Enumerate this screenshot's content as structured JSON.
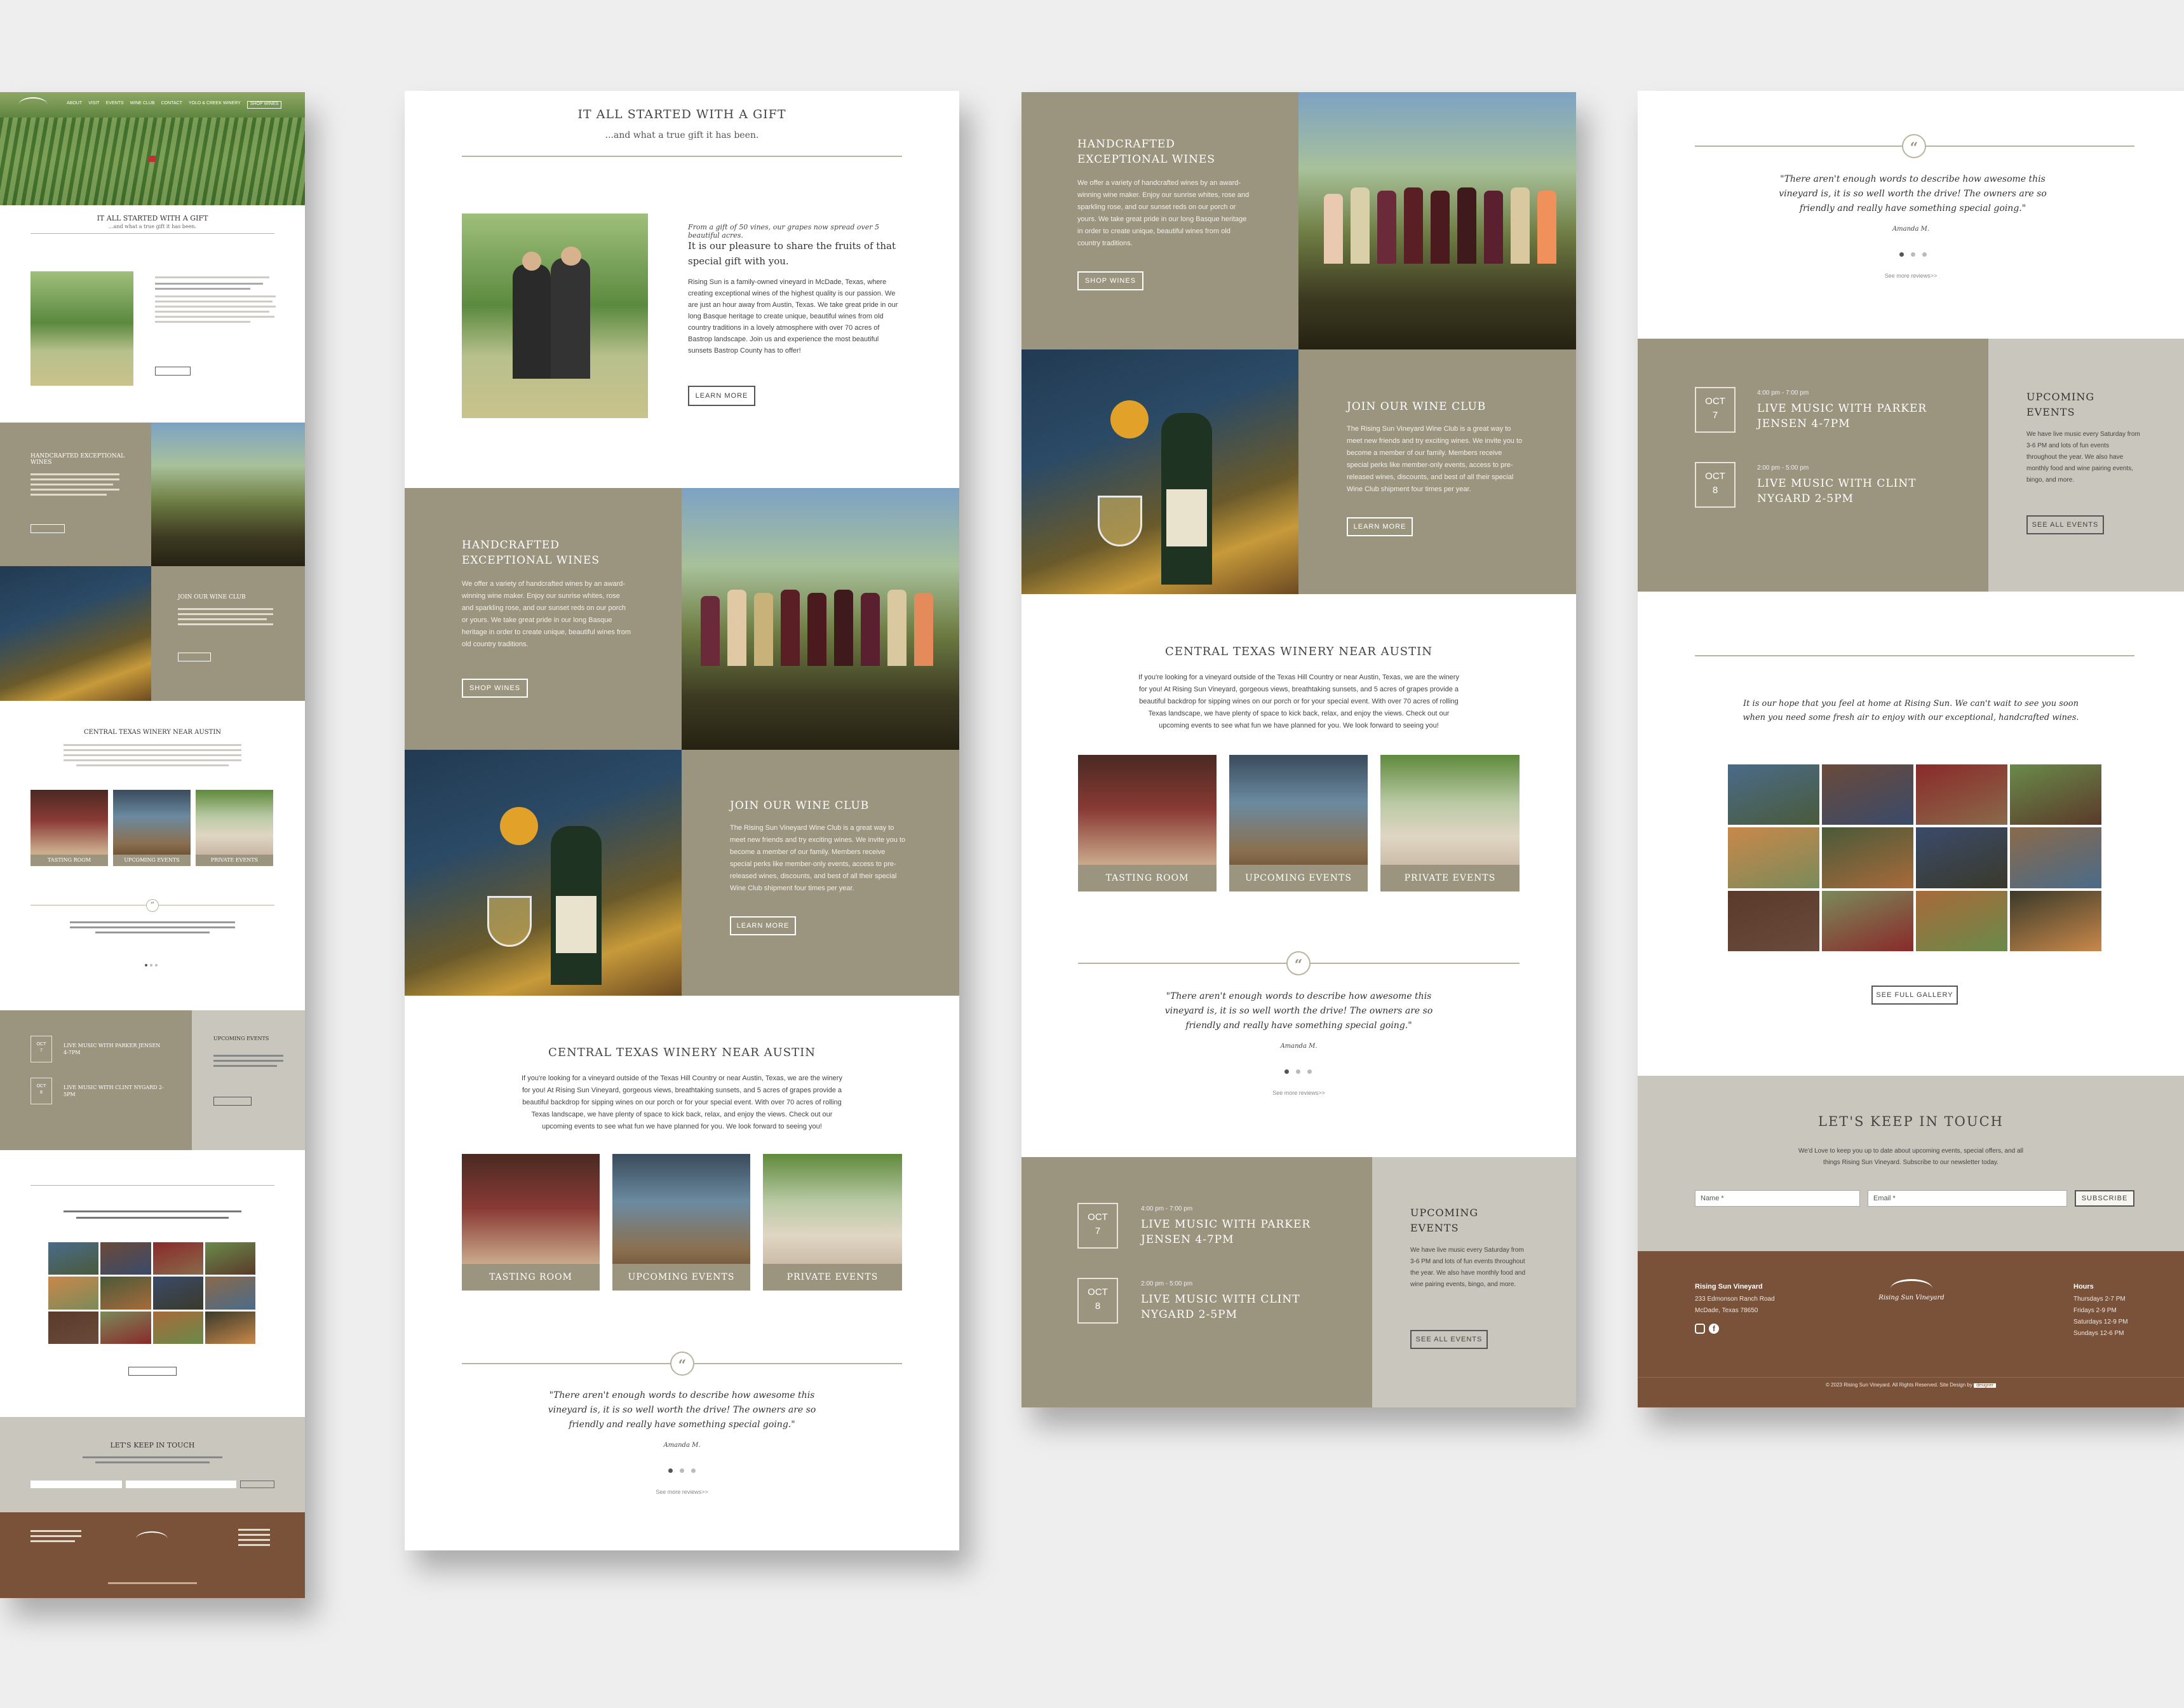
{
  "nav": {
    "links": [
      "ABOUT",
      "VISIT",
      "EVENTS",
      "WINE CLUB",
      "CONTACT",
      "YOLO & CREEK WINERY"
    ],
    "button": "SHOP WINES"
  },
  "intro": {
    "heading": "IT ALL STARTED WITH A GIFT",
    "subheading": "...and what a true gift it has been.",
    "italic_lead": "From a gift of 50 vines, our grapes now spread over 5 beautiful acres.",
    "lead": "It is our pleasure to share the fruits of that special gift with you.",
    "body": "Rising Sun is a family-owned vineyard in McDade, Texas, where creating exceptional wines of the highest quality is our passion. We are just an hour away from Austin, Texas. We take great pride in our long Basque heritage to create unique, beautiful wines from old country traditions in a lovely atmosphere with over 70 acres of Bastrop landscape. Join us and experience the most beautiful sunsets Bastrop County has to offer!",
    "button": "LEARN MORE"
  },
  "handcrafted": {
    "title": "HANDCRAFTED EXCEPTIONAL WINES",
    "body": "We offer a variety of handcrafted wines by an award-winning wine maker. Enjoy our sunrise whites, rose and sparkling rose, and our sunset reds on our porch or yours. We take great pride in our long Basque heritage in order to create unique, beautiful wines from old country traditions.",
    "button": "SHOP WINES"
  },
  "club": {
    "title": "JOIN OUR WINE CLUB",
    "body": "The Rising Sun Vineyard Wine Club is a great way to meet new friends and try exciting wines. We invite you to become a member of our family. Members receive special perks like member-only events, access to pre-released wines, discounts, and best of all their special Wine Club shipment four times per year.",
    "button": "LEARN MORE"
  },
  "winery": {
    "title": "CENTRAL TEXAS WINERY NEAR AUSTIN",
    "body": "If you're looking for a vineyard outside of the Texas Hill Country or near Austin, Texas, we are the winery for you! At Rising Sun Vineyard, gorgeous views, breathtaking sunsets, and 5 acres of grapes provide a beautiful backdrop for sipping wines on our porch or for your special event. With over 70 acres of rolling Texas landscape, we have plenty of space to kick back, relax, and enjoy the views. Check out our upcoming events to see what fun we have planned for you. We look forward to seeing you!",
    "cards": [
      "TASTING ROOM",
      "UPCOMING EVENTS",
      "PRIVATE EVENTS"
    ]
  },
  "testimonial": {
    "mark": "“",
    "quote": "\"There aren't enough words to describe how awesome this vineyard is, it is so well worth the drive! The owners are so friendly and really have something special going.\"",
    "author": "Amanda M.",
    "more": "See more reviews>>"
  },
  "events": {
    "items": [
      {
        "month": "OCT",
        "day": "7",
        "time": "4:00 pm - 7:00 pm",
        "title": "LIVE MUSIC WITH PARKER JENSEN 4-7PM"
      },
      {
        "month": "OCT",
        "day": "8",
        "time": "2:00 pm - 5:00 pm",
        "title": "LIVE MUSIC WITH CLINT NYGARD 2-5PM"
      }
    ],
    "side_title": "UPCOMING EVENTS",
    "side_body": "We have live music every Saturday from 3-6 PM and lots of fun events throughout the year. We also have monthly food and wine pairing events, bingo, and more.",
    "button": "SEE ALL EVENTS"
  },
  "gallery": {
    "intro": "It is our hope that you feel at home at Rising Sun. We can't wait to see you soon when you need some fresh air to enjoy with our exceptional, handcrafted wines.",
    "button": "SEE FULL GALLERY"
  },
  "newsletter": {
    "title": "LET'S KEEP IN TOUCH",
    "body": "We'd Love to keep you up to date about upcoming events, special offers, and all things Rising Sun Vineyard. Subscribe to our newsletter today.",
    "name_placeholder": "Name *",
    "email_placeholder": "Email *",
    "button": "SUBSCRIBE"
  },
  "footer": {
    "name": "Rising Sun Vineyard",
    "address1": "233 Edmonson Ranch Road",
    "address2": "McDade, Texas 78650",
    "logo_text": "Rising Sun Vineyard",
    "hours_title": "Hours",
    "hours": [
      "Thursdays 2-7 PM",
      "Fridays 2-9 PM",
      "Saturdays 12-9 PM",
      "Sundays 12-6 PM"
    ],
    "copyright": "© 2023 Rising Sun Vineyard. All Rights Reserved. Site Design by",
    "badge": "designer"
  },
  "colors": {
    "taupe": "#9b9580",
    "light_gray": "#c9c7bd",
    "brown": "#7a5139",
    "background": "#eeeeee"
  }
}
